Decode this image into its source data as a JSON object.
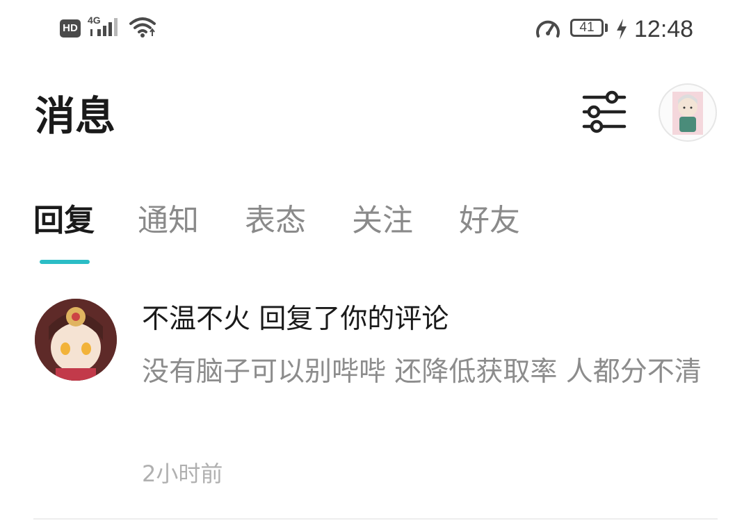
{
  "status_bar": {
    "hd_label": "HD",
    "network_label": "4G",
    "battery_level": "41",
    "time": "12:48",
    "icons": [
      "signal-icon",
      "wifi-icon",
      "speedometer-icon",
      "battery-icon",
      "charging-bolt-icon"
    ]
  },
  "header": {
    "title": "消息",
    "filter_icon": "sliders-icon",
    "avatar_icon": "user-avatar"
  },
  "tabs": [
    {
      "label": "回复",
      "active": true
    },
    {
      "label": "通知",
      "active": false
    },
    {
      "label": "表态",
      "active": false
    },
    {
      "label": "关注",
      "active": false
    },
    {
      "label": "好友",
      "active": false
    }
  ],
  "messages": [
    {
      "sender": "不温不火",
      "title": "不温不火 回复了你的评论",
      "body": "没有脑子可以别哔哔 还降低获取率 人都分不清",
      "time": "2小时前"
    }
  ],
  "colors": {
    "accent": "#2bbdc6",
    "text_primary": "#1a1a1a",
    "text_secondary": "#8c8c8c",
    "text_muted": "#b0b0b0"
  }
}
